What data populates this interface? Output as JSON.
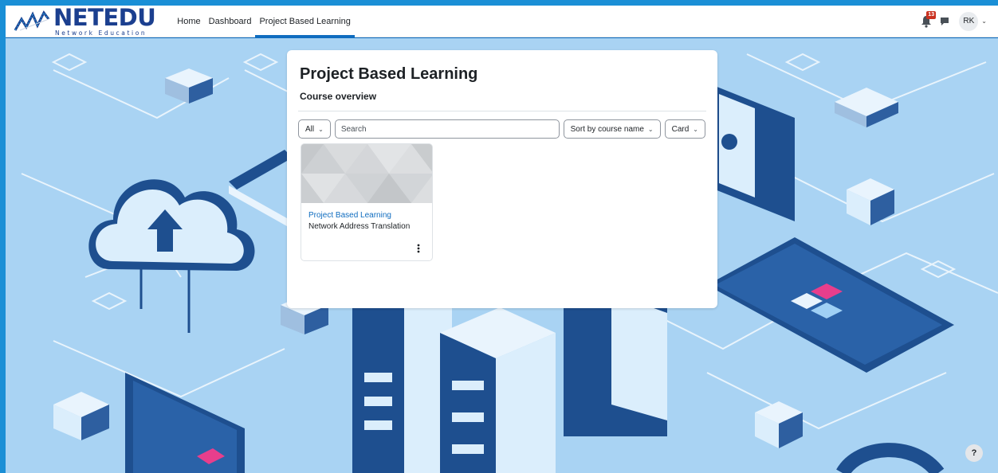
{
  "brand": {
    "name": "NETEDU",
    "tagline": "Network Education"
  },
  "nav": {
    "links": [
      {
        "label": "Home"
      },
      {
        "label": "Dashboard"
      },
      {
        "label": "Project Based Learning"
      }
    ],
    "active_index": 2,
    "notification_count": "13",
    "user_initials": "RK"
  },
  "page": {
    "title": "Project Based Learning",
    "section": "Course overview"
  },
  "filters": {
    "grouping": "All",
    "search_placeholder": "Search",
    "sort": "Sort by course name",
    "view": "Card"
  },
  "courses": [
    {
      "category": "Project Based Learning",
      "name": "Network Address Translation"
    }
  ],
  "help": {
    "label": "?"
  },
  "colors": {
    "accent": "#0f6cbf",
    "brand": "#1b3f8f",
    "badge": "#ca3120",
    "background": "#a9d3f3"
  }
}
